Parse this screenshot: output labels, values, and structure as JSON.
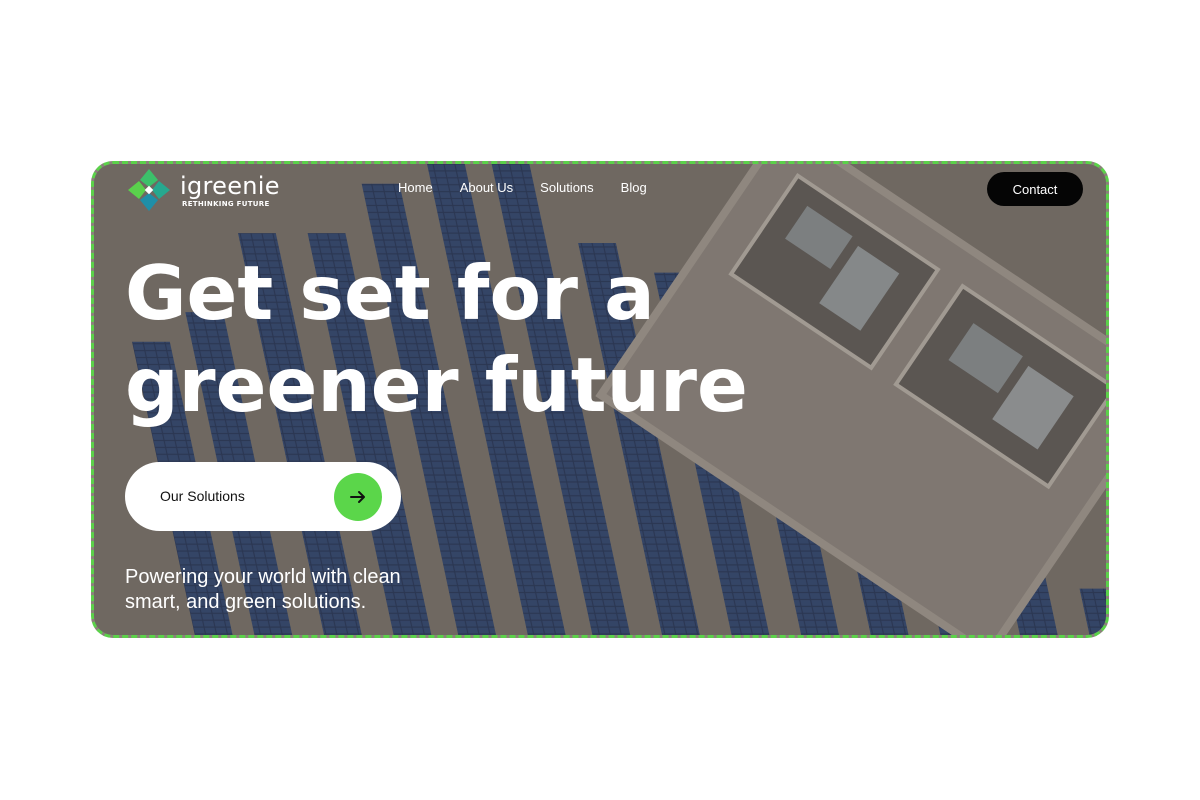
{
  "brand": {
    "name": "igreenie",
    "tagline": "RETHINKING FUTURE"
  },
  "nav": {
    "items": [
      "Home",
      "About Us",
      "Solutions",
      "Blog"
    ],
    "contact_label": "Contact"
  },
  "hero": {
    "headline_line1": "Get set for a",
    "headline_line2": "greener future",
    "cta_label": "Our Solutions",
    "cta_icon": "arrow-right-icon",
    "subtext_line1": "Powering your world with clean",
    "subtext_line2": "smart, and green solutions."
  },
  "colors": {
    "accent": "#5bd64a",
    "dark_button": "#050505",
    "frame_border": "#5bd14a"
  }
}
